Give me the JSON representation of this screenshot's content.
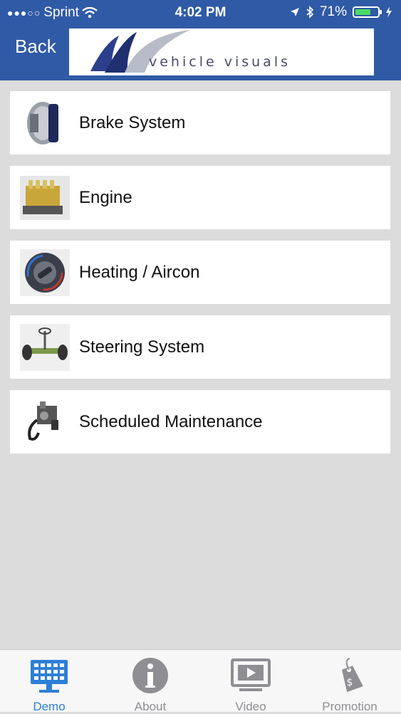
{
  "status_bar": {
    "carrier": "Sprint",
    "time": "4:02 PM",
    "battery_percent": "71%",
    "battery_level": 0.71,
    "battery_color": "#4cd964"
  },
  "nav": {
    "back_label": "Back",
    "logo_text": "vehicle visuals"
  },
  "menu": {
    "items": [
      {
        "label": "Brake System",
        "icon": "brake-disc-icon"
      },
      {
        "label": "Engine",
        "icon": "engine-icon"
      },
      {
        "label": "Heating / Aircon",
        "icon": "climate-dial-icon"
      },
      {
        "label": "Steering System",
        "icon": "steering-icon"
      },
      {
        "label": "Scheduled Maintenance",
        "icon": "maintenance-icon"
      }
    ]
  },
  "tabbar": {
    "tabs": [
      {
        "label": "Demo",
        "icon": "monitor-grid-icon",
        "active": true
      },
      {
        "label": "About",
        "icon": "info-icon",
        "active": false
      },
      {
        "label": "Video",
        "icon": "video-icon",
        "active": false
      },
      {
        "label": "Promotion",
        "icon": "price-tag-icon",
        "active": false
      }
    ]
  },
  "colors": {
    "header": "#2f5aa6",
    "active_tab": "#2e7fd6",
    "inactive_tab": "#8e8e93",
    "background": "#dcdcdc"
  }
}
